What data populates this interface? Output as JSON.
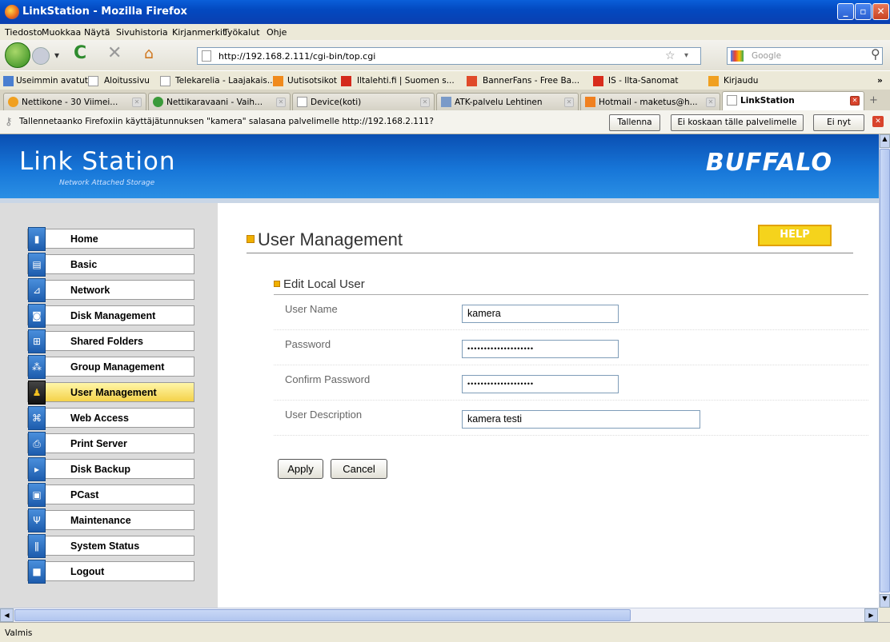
{
  "window": {
    "title": "LinkStation - Mozilla Firefox"
  },
  "menu": [
    "Tiedosto",
    "Muokkaa",
    "Näytä",
    "Sivuhistoria",
    "Kirjanmerkit",
    "Työkalut",
    "Ohje"
  ],
  "address": {
    "url": "http://192.168.2.111/cgi-bin/top.cgi",
    "search_placeholder": "Google"
  },
  "bookmarks": [
    "Useimmin avatut",
    "Aloitussivu",
    "Telekarelia - Laajakais...",
    "Uutisotsikot",
    "Iltalehti.fi | Suomen s...",
    "BannerFans - Free Ba...",
    "IS - Ilta-Sanomat",
    "Kirjaudu"
  ],
  "tabs": [
    "Nettikone - 30 Viimei...",
    "Nettikaravaani - Vaih...",
    "Device(koti)",
    "ATK-palvelu Lehtinen",
    "Hotmail - maketus@h...",
    "LinkStation"
  ],
  "notification": {
    "message": "Tallennetaanko Firefoxiin käyttäjätunnuksen \"kamera\" salasana palvelimelle http://192.168.2.111?",
    "save": "Tallenna",
    "never": "Ei koskaan tälle palvelimelle",
    "not_now": "Ei nyt"
  },
  "banner": {
    "logo": "Link Station",
    "subtitle": "Network Attached Storage",
    "brand": "BUFFALO"
  },
  "sidebar": {
    "items": [
      {
        "label": "Home"
      },
      {
        "label": "Basic"
      },
      {
        "label": "Network"
      },
      {
        "label": "Disk Management"
      },
      {
        "label": "Shared Folders"
      },
      {
        "label": "Group Management"
      },
      {
        "label": "User Management"
      },
      {
        "label": "Web Access"
      },
      {
        "label": "Print Server"
      },
      {
        "label": "Disk Backup"
      },
      {
        "label": "PCast"
      },
      {
        "label": "Maintenance"
      },
      {
        "label": "System Status"
      },
      {
        "label": "Logout"
      }
    ],
    "active": "User Management"
  },
  "main": {
    "title": "User Management",
    "help": "HELP",
    "section": "Edit Local User",
    "fields": [
      {
        "label": "User Name",
        "value": "kamera"
      },
      {
        "label": "Password",
        "value": "••••••••••••••••••••"
      },
      {
        "label": "Confirm Password",
        "value": "••••••••••••••••••••"
      },
      {
        "label": "User Description",
        "value": "kamera testi"
      }
    ],
    "apply": "Apply",
    "cancel": "Cancel"
  },
  "status": "Valmis",
  "colors": {
    "banner": "#1776d8",
    "active_nav": "#f4d24a",
    "help": "#f5d31c"
  }
}
